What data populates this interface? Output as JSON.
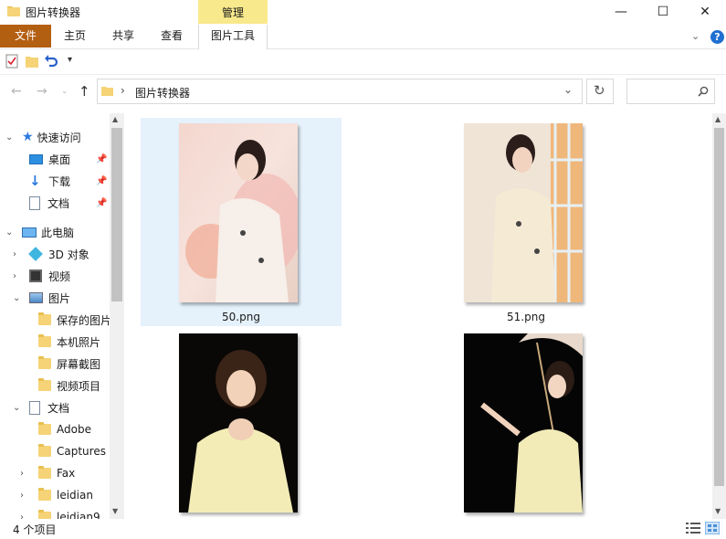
{
  "window": {
    "title": "图片转换器",
    "contextual_tab": "管理",
    "minimize": "—",
    "maximize": "☐",
    "close": "✕"
  },
  "ribbon": {
    "tabs": [
      "文件",
      "主页",
      "共享",
      "查看",
      "图片工具"
    ],
    "help": "?"
  },
  "address": {
    "separator": "›",
    "path": "图片转换器",
    "search_placeholder": ""
  },
  "nav": {
    "quick_access": "快速访问",
    "quick_items": [
      "桌面",
      "下载",
      "文档"
    ],
    "this_pc": "此电脑",
    "pc_items": [
      "3D 对象",
      "视频",
      "图片"
    ],
    "picture_children": [
      "保存的图片",
      "本机照片",
      "屏幕截图",
      "视频项目"
    ],
    "documents": "文档",
    "doc_children": [
      "Adobe",
      "Captures",
      "Fax",
      "leidian",
      "leidian9"
    ]
  },
  "files": [
    {
      "name": "50.png",
      "selected": true
    },
    {
      "name": "51.png",
      "selected": false
    },
    {
      "name": "",
      "selected": false
    },
    {
      "name": "",
      "selected": false
    }
  ],
  "status": {
    "count": "4 个项目"
  },
  "colors": {
    "file_tab": "#b35f12",
    "manage_tab": "#f8e98c",
    "selection": "#e5f1fb",
    "folder": "#f5d376",
    "accent_blue": "#1f6fd1"
  }
}
